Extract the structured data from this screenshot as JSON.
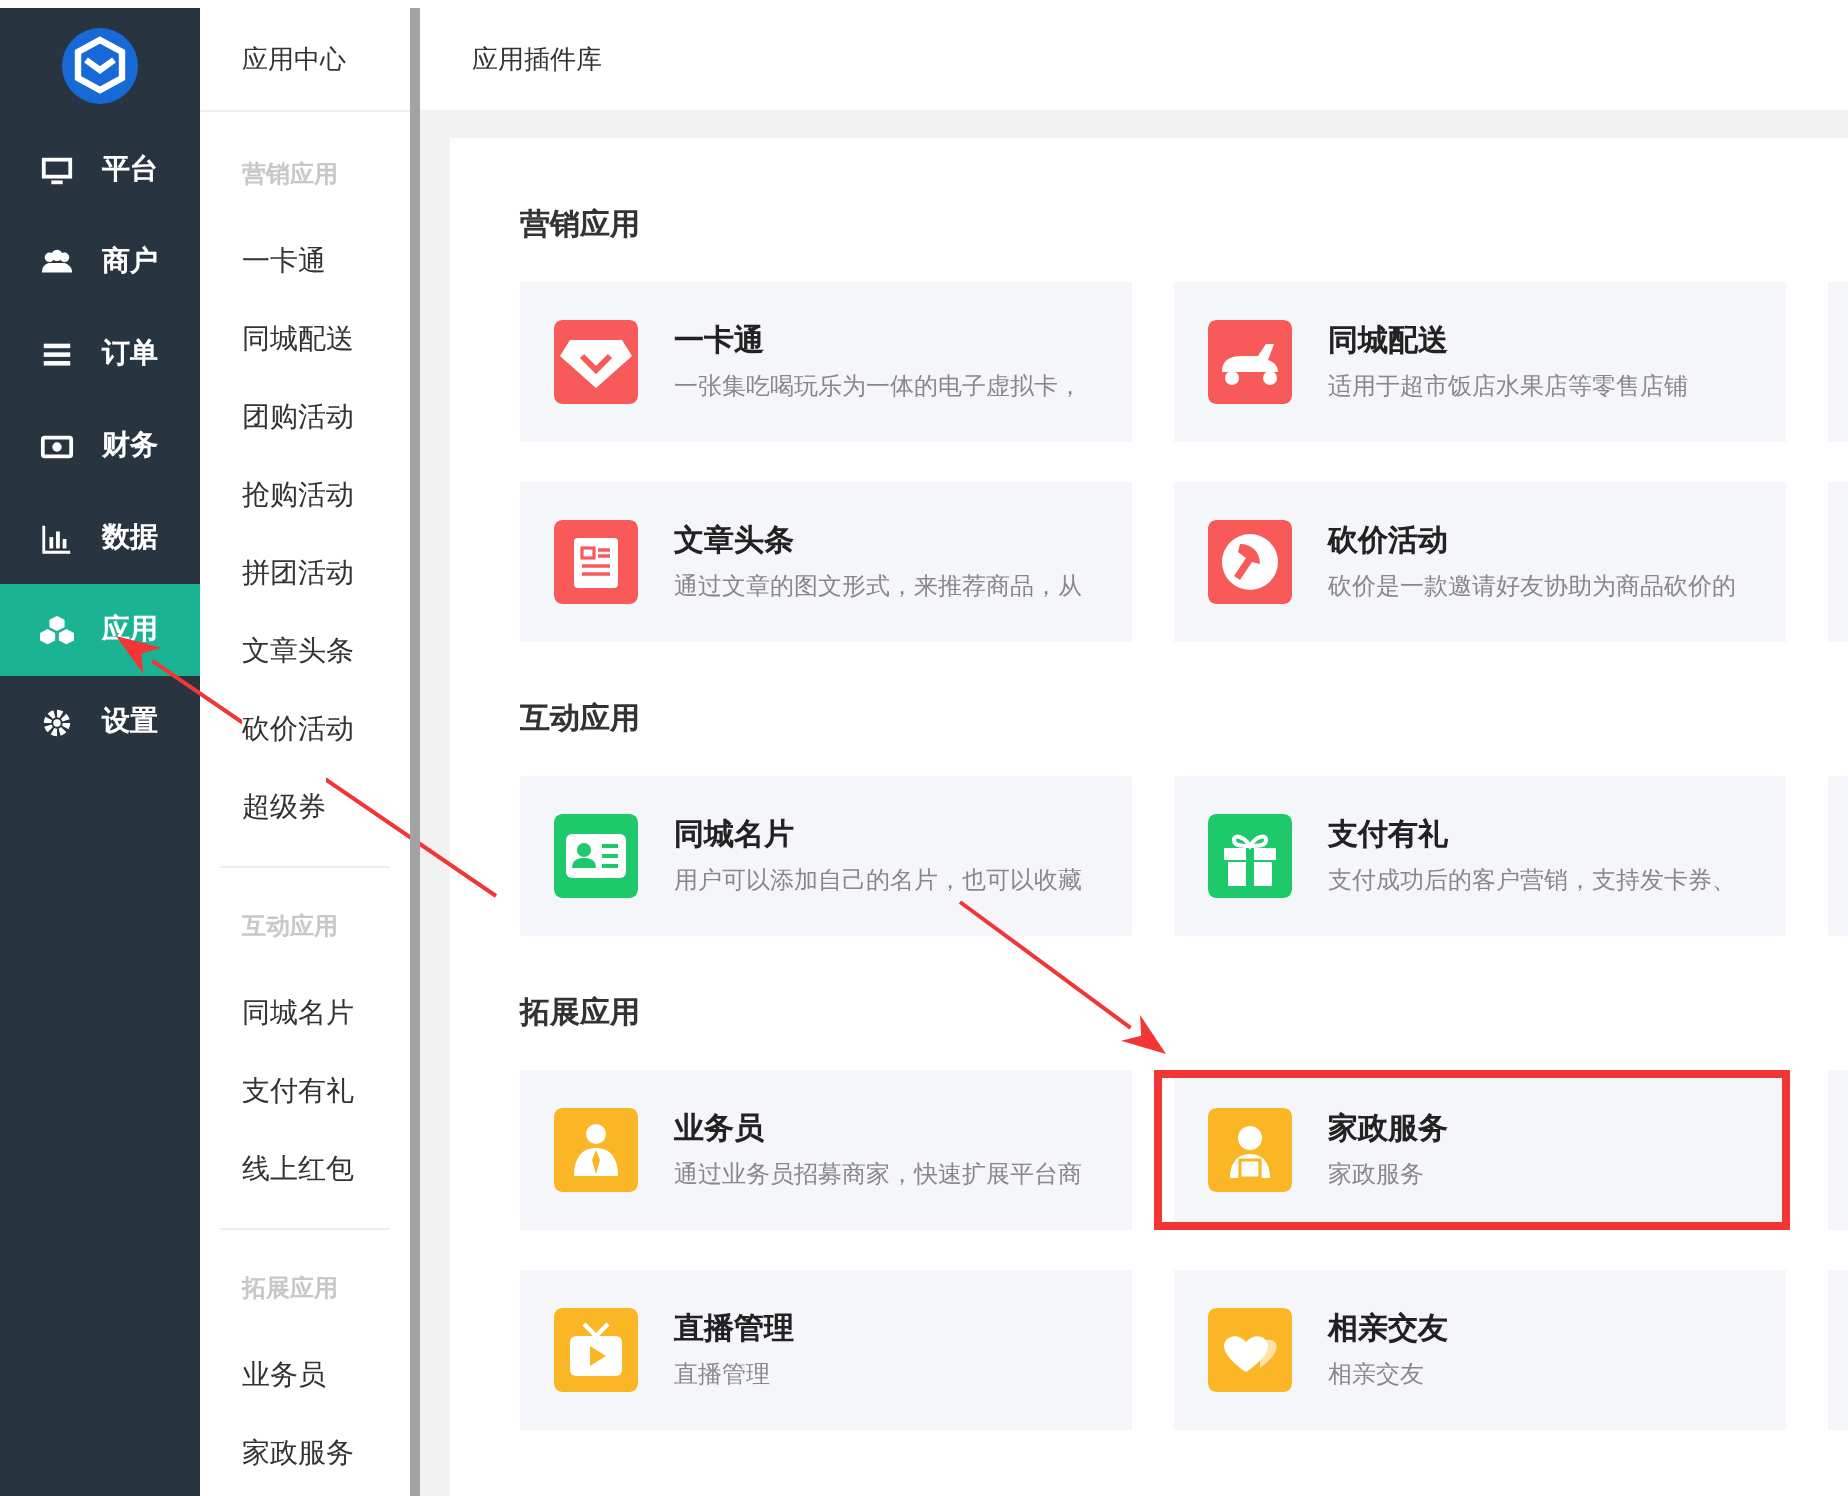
{
  "nav": {
    "items": [
      {
        "label": "平台",
        "selected": false
      },
      {
        "label": "商户",
        "selected": false
      },
      {
        "label": "订单",
        "selected": false
      },
      {
        "label": "财务",
        "selected": false
      },
      {
        "label": "数据",
        "selected": false
      },
      {
        "label": "应用",
        "selected": true
      },
      {
        "label": "设置",
        "selected": false
      }
    ]
  },
  "submenu": {
    "title": "应用中心",
    "groups": [
      {
        "label": "营销应用",
        "items": [
          "一卡通",
          "同城配送",
          "团购活动",
          "抢购活动",
          "拼团活动",
          "文章头条",
          "砍价活动",
          "超级券"
        ]
      },
      {
        "label": "互动应用",
        "items": [
          "同城名片",
          "支付有礼",
          "线上红包"
        ]
      },
      {
        "label": "拓展应用",
        "items": [
          "业务员",
          "家政服务"
        ]
      }
    ]
  },
  "header": {
    "title": "应用插件库"
  },
  "sections": [
    {
      "title": "营销应用",
      "cards": [
        {
          "title": "一卡通",
          "desc": "一张集吃喝玩乐为一体的电子虚拟卡，",
          "color": "#f85a5a",
          "highlighted": false
        },
        {
          "title": "同城配送",
          "desc": "适用于超市饭店水果店等零售店铺",
          "color": "#f85a5a",
          "highlighted": false
        },
        {
          "title": "文章头条",
          "desc": "通过文章的图文形式，来推荐商品，从",
          "color": "#f85a5a",
          "highlighted": false
        },
        {
          "title": "砍价活动",
          "desc": "砍价是一款邀请好友协助为商品砍价的",
          "color": "#f85a5a",
          "highlighted": false
        }
      ]
    },
    {
      "title": "互动应用",
      "cards": [
        {
          "title": "同城名片",
          "desc": "用户可以添加自己的名片，也可以收藏",
          "color": "#1ec96b",
          "highlighted": false
        },
        {
          "title": "支付有礼",
          "desc": "支付成功后的客户营销，支持发卡券、",
          "color": "#1ec96b",
          "highlighted": false
        }
      ]
    },
    {
      "title": "拓展应用",
      "cards": [
        {
          "title": "业务员",
          "desc": "通过业务员招募商家，快速扩展平台商",
          "color": "#fbb625",
          "highlighted": false
        },
        {
          "title": "家政服务",
          "desc": "家政服务",
          "color": "#fbb625",
          "highlighted": true
        },
        {
          "title": "直播管理",
          "desc": "直播管理",
          "color": "#fbb625",
          "highlighted": false
        },
        {
          "title": "相亲交友",
          "desc": "相亲交友",
          "color": "#fbb625",
          "highlighted": false
        }
      ]
    }
  ],
  "annotations": [
    {
      "kind": "arrow"
    },
    {
      "kind": "arrow"
    }
  ]
}
